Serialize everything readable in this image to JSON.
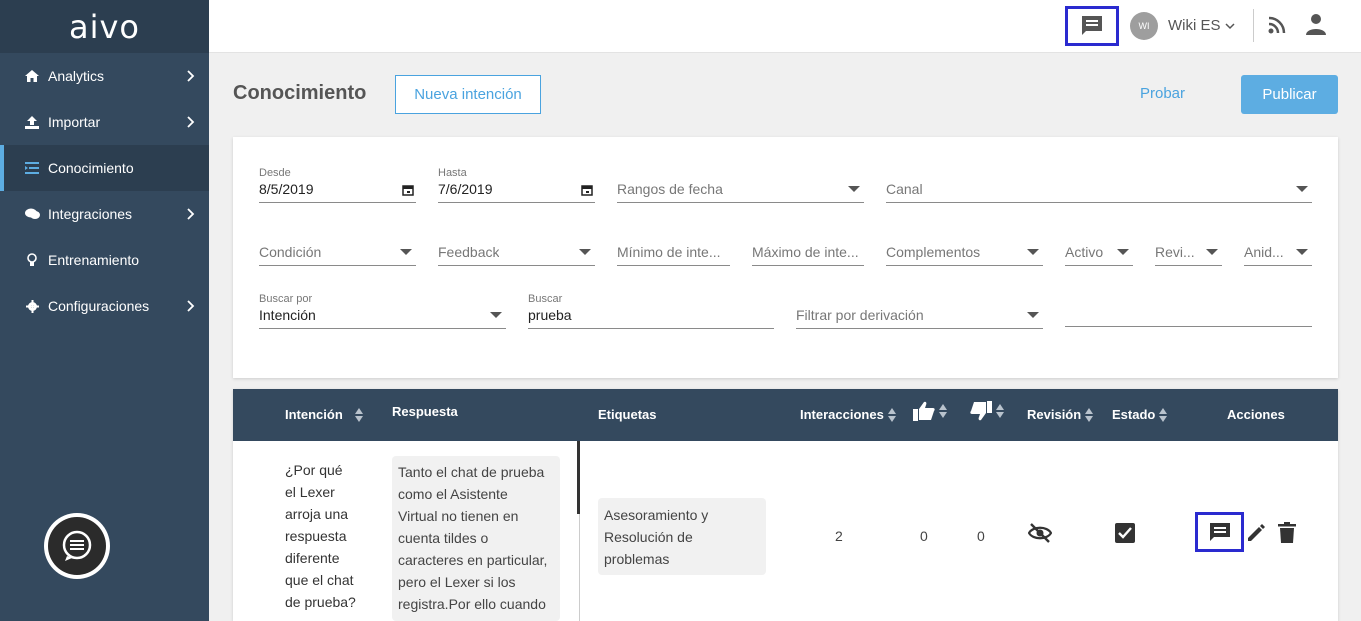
{
  "brand": {
    "logo": "aivo"
  },
  "sidebar": {
    "items": [
      {
        "label": "Analytics",
        "icon": "home-icon",
        "has_chevron": true
      },
      {
        "label": "Importar",
        "icon": "upload-icon",
        "has_chevron": true
      },
      {
        "label": "Conocimiento",
        "icon": "list-icon",
        "has_chevron": false,
        "active": true
      },
      {
        "label": "Integraciones",
        "icon": "chat-bubbles-icon",
        "has_chevron": true
      },
      {
        "label": "Entrenamiento",
        "icon": "lightbulb-icon",
        "has_chevron": false
      },
      {
        "label": "Configuraciones",
        "icon": "gear-icon",
        "has_chevron": true
      }
    ]
  },
  "topbar": {
    "avatar_initials": "WI",
    "workspace": "Wiki ES"
  },
  "header": {
    "title": "Conocimiento",
    "new_intent_label": "Nueva intención",
    "test_label": "Probar",
    "publish_label": "Publicar"
  },
  "filters": {
    "desde": {
      "label": "Desde",
      "value": "8/5/2019"
    },
    "hasta": {
      "label": "Hasta",
      "value": "7/6/2019"
    },
    "rangos": {
      "placeholder": "Rangos de fecha"
    },
    "canal": {
      "placeholder": "Canal"
    },
    "condicion": {
      "placeholder": "Condición"
    },
    "feedback": {
      "placeholder": "Feedback"
    },
    "minimo": {
      "placeholder": "Mínimo de inte..."
    },
    "maximo": {
      "placeholder": "Máximo de inte..."
    },
    "complementos": {
      "placeholder": "Complementos"
    },
    "activo": {
      "placeholder": "Activo"
    },
    "revision": {
      "placeholder": "Revi..."
    },
    "anidado": {
      "placeholder": "Anid..."
    },
    "buscar_por": {
      "label": "Buscar por",
      "value": "Intención"
    },
    "buscar": {
      "label": "Buscar",
      "value": "prueba"
    },
    "derivacion": {
      "placeholder": "Filtrar por derivación"
    }
  },
  "table": {
    "headers": {
      "intencion": "Intención",
      "respuesta": "Respuesta",
      "etiquetas": "Etiquetas",
      "interacciones": "Interacciones",
      "revision": "Revisión",
      "estado": "Estado",
      "acciones": "Acciones"
    },
    "rows": [
      {
        "intencion": [
          "¿Por qué",
          "el Lexer",
          "arroja una",
          "respuesta",
          "diferente",
          "que el chat",
          "de prueba?"
        ],
        "respuesta": [
          "Tanto el chat de prueba",
          "como el Asistente",
          "Virtual no tienen en",
          "cuenta tildes o",
          "caracteres en particular,",
          "pero el Lexer si los",
          "registra.Por ello cuando"
        ],
        "etiqueta": [
          "Asesoramiento y",
          "Resolución de",
          "problemas"
        ],
        "interacciones": "2",
        "likes": "0",
        "dislikes": "0"
      }
    ]
  }
}
